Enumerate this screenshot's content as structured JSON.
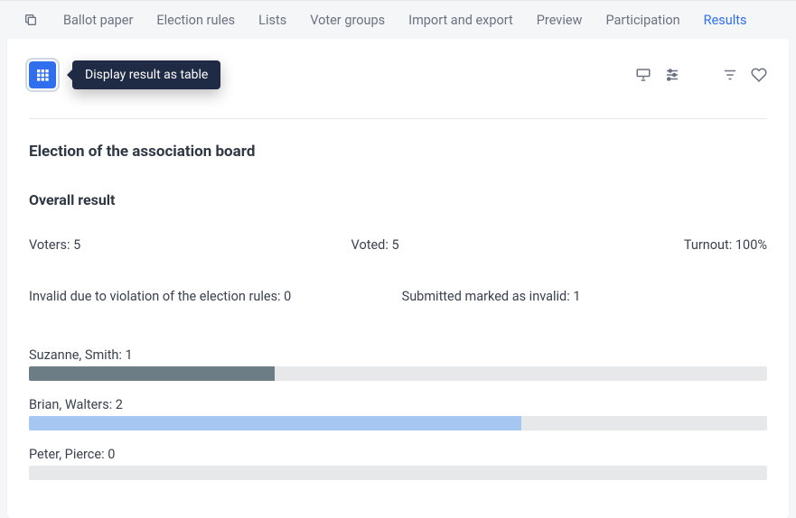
{
  "nav": {
    "tabs": [
      {
        "label": "Ballot paper",
        "active": false
      },
      {
        "label": "Election rules",
        "active": false
      },
      {
        "label": "Lists",
        "active": false
      },
      {
        "label": "Voter groups",
        "active": false
      },
      {
        "label": "Import and export",
        "active": false
      },
      {
        "label": "Preview",
        "active": false
      },
      {
        "label": "Participation",
        "active": false
      },
      {
        "label": "Results",
        "active": true
      }
    ]
  },
  "tooltip": "Display result as table",
  "page_title": "Election of the association board",
  "section_title": "Overall result",
  "stats": {
    "voters_label": "Voters:",
    "voters_value": "5",
    "voted_label": "Voted:",
    "voted_value": "5",
    "turnout_label": "Turnout:",
    "turnout_value": "100%",
    "invalid_label": "Invalid due to violation of the election rules:",
    "invalid_value": "0",
    "marked_label": "Submitted marked as invalid:",
    "marked_value": "1"
  },
  "max_votes": 3,
  "candidates": [
    {
      "name": "Suzanne, Smith",
      "votes": 1,
      "color": "#6c7d85"
    },
    {
      "name": "Brian, Walters",
      "votes": 2,
      "color": "#a6c7f2"
    },
    {
      "name": "Peter, Pierce",
      "votes": 0,
      "color": "#6c7d85"
    }
  ]
}
